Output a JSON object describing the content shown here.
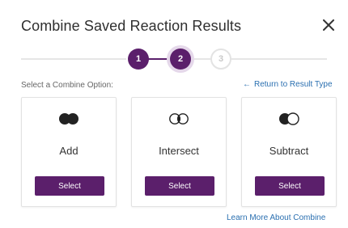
{
  "dialog": {
    "title": "Combine Saved Reaction Results",
    "close_icon": "close-icon"
  },
  "stepper": {
    "steps": [
      {
        "label": "1",
        "state": "done"
      },
      {
        "label": "2",
        "state": "active"
      },
      {
        "label": "3",
        "state": "todo"
      }
    ]
  },
  "options": {
    "prompt": "Select a Combine Option:",
    "return_link": "Return to Result Type",
    "return_icon": "arrow-left-icon",
    "cards": [
      {
        "label": "Add",
        "icon": "venn-union-icon",
        "button": "Select"
      },
      {
        "label": "Intersect",
        "icon": "venn-intersect-icon",
        "button": "Select"
      },
      {
        "label": "Subtract",
        "icon": "venn-subtract-icon",
        "button": "Select"
      }
    ]
  },
  "footer": {
    "learn_more": "Learn More About Combine"
  },
  "colors": {
    "accent": "#5b1f6b",
    "link": "#2a6fb0"
  }
}
